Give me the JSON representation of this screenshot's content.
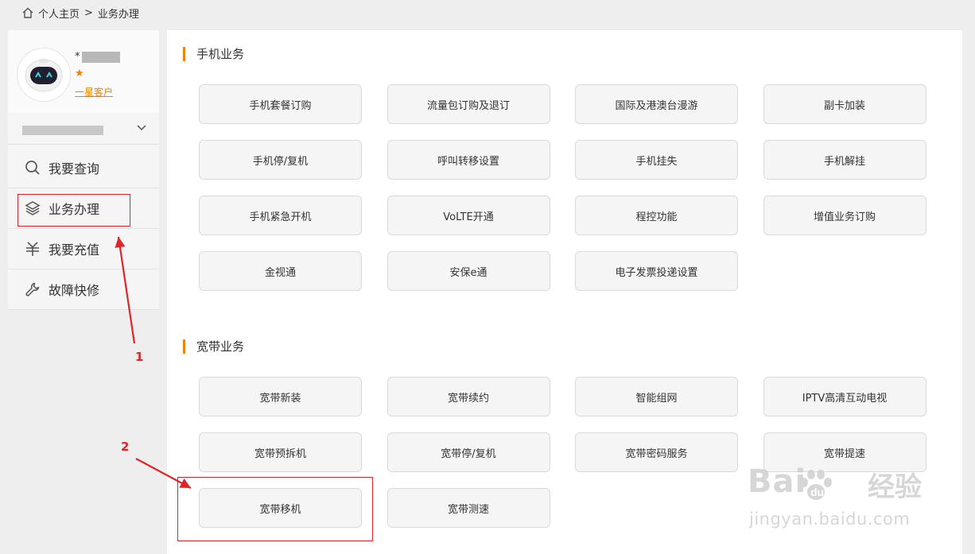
{
  "breadcrumb": {
    "home": "个人主页",
    "separator": ">",
    "current": "业务办理"
  },
  "profile": {
    "name_prefix": "*",
    "level": "一星客户"
  },
  "menu": [
    {
      "label": "我要查询",
      "icon": "search-icon"
    },
    {
      "label": "业务办理",
      "icon": "layers-icon"
    },
    {
      "label": "我要充值",
      "icon": "yuan-icon"
    },
    {
      "label": "故障快修",
      "icon": "wrench-icon"
    }
  ],
  "mobile": {
    "title": "手机业务",
    "items": [
      "手机套餐订购",
      "流量包订购及退订",
      "国际及港澳台漫游",
      "副卡加装",
      "手机停/复机",
      "呼叫转移设置",
      "手机挂失",
      "手机解挂",
      "手机紧急开机",
      "VoLTE开通",
      "程控功能",
      "增值业务订购",
      "金视通",
      "安保e通",
      "电子发票投递设置"
    ]
  },
  "broadband": {
    "title": "宽带业务",
    "items": [
      "宽带新装",
      "宽带续约",
      "智能组网",
      "IPTV高清互动电视",
      "宽带预拆机",
      "宽带停/复机",
      "宽带密码服务",
      "宽带提速",
      "宽带移机",
      "宽带测速"
    ]
  },
  "annotations": {
    "step1": "1",
    "step2": "2",
    "color": "#e0242a"
  },
  "watermark": {
    "brand": "Bai",
    "brand_cn": "经验",
    "url": "jingyan.baidu.com"
  },
  "colors": {
    "accent": "#f08300",
    "button_bg": "#f5f5f5",
    "page_bg": "#eeeeee"
  }
}
